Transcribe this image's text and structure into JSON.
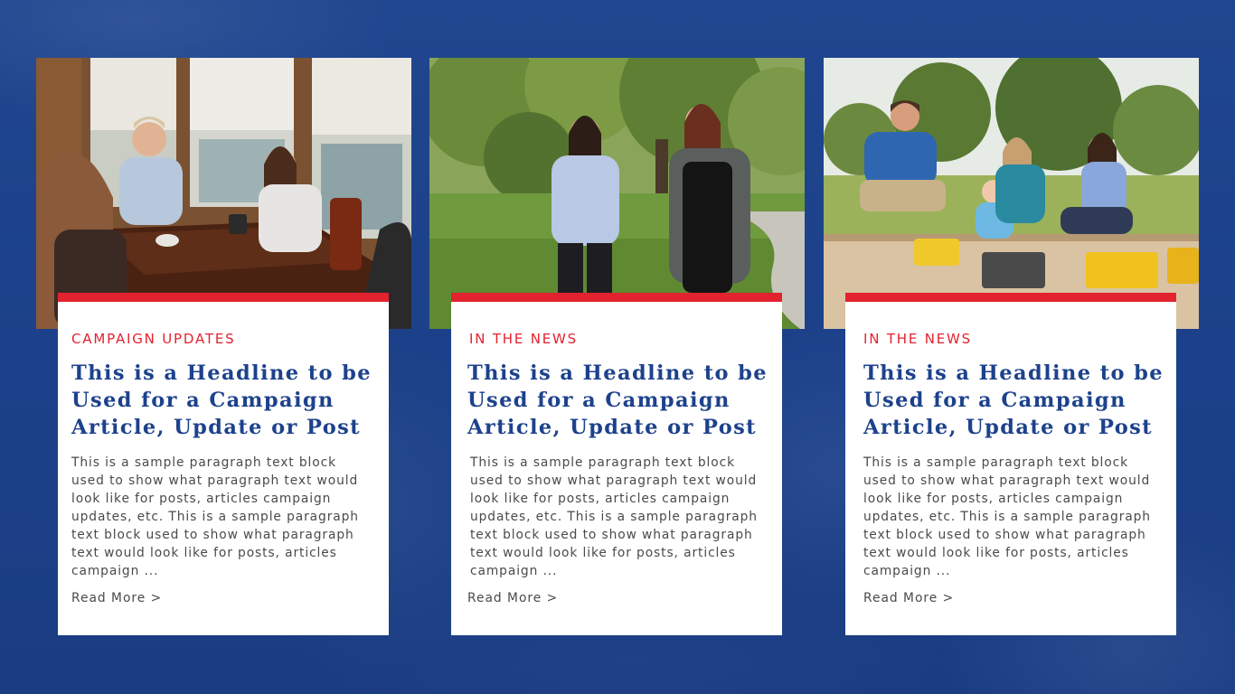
{
  "colors": {
    "background": "#1d428c",
    "accent_red": "#e3222f",
    "headline_blue": "#1d428c",
    "body_text": "#4a4a4a",
    "card_bg": "#ffffff"
  },
  "cards": [
    {
      "photo": "photo-family-conversation-indoors",
      "category": "CAMPAIGN UPDATES",
      "headline": "This is a Headline to be Used for a Campaign Article, Update or Post",
      "excerpt": "This is a sample paragraph text block used to show what paragraph text would look like for posts, articles campaign updates, etc. This is a sample paragraph text block used to show what paragraph text would look like for posts, articles campaign ...",
      "read_more": "Read More >"
    },
    {
      "photo": "photo-two-women-walking-park",
      "category": "IN THE NEWS",
      "headline": "This is a Headline to be Used for a Campaign Article, Update or Post",
      "excerpt": "This is a sample paragraph text block used to show what paragraph text would look like for posts, articles campaign updates, etc. This is a sample paragraph text block used to show what paragraph text would look like for posts, articles campaign ...",
      "read_more": "Read More >"
    },
    {
      "photo": "photo-family-playground-sandbox",
      "category": "IN THE NEWS",
      "headline": "This is a Headline to be Used for a Campaign Article, Update or Post",
      "excerpt": "This is a sample paragraph text block used to show what paragraph text would look like for posts, articles campaign updates, etc. This is a sample paragraph text block used to show what paragraph text would look like for posts, articles campaign ...",
      "read_more": "Read More >"
    }
  ]
}
